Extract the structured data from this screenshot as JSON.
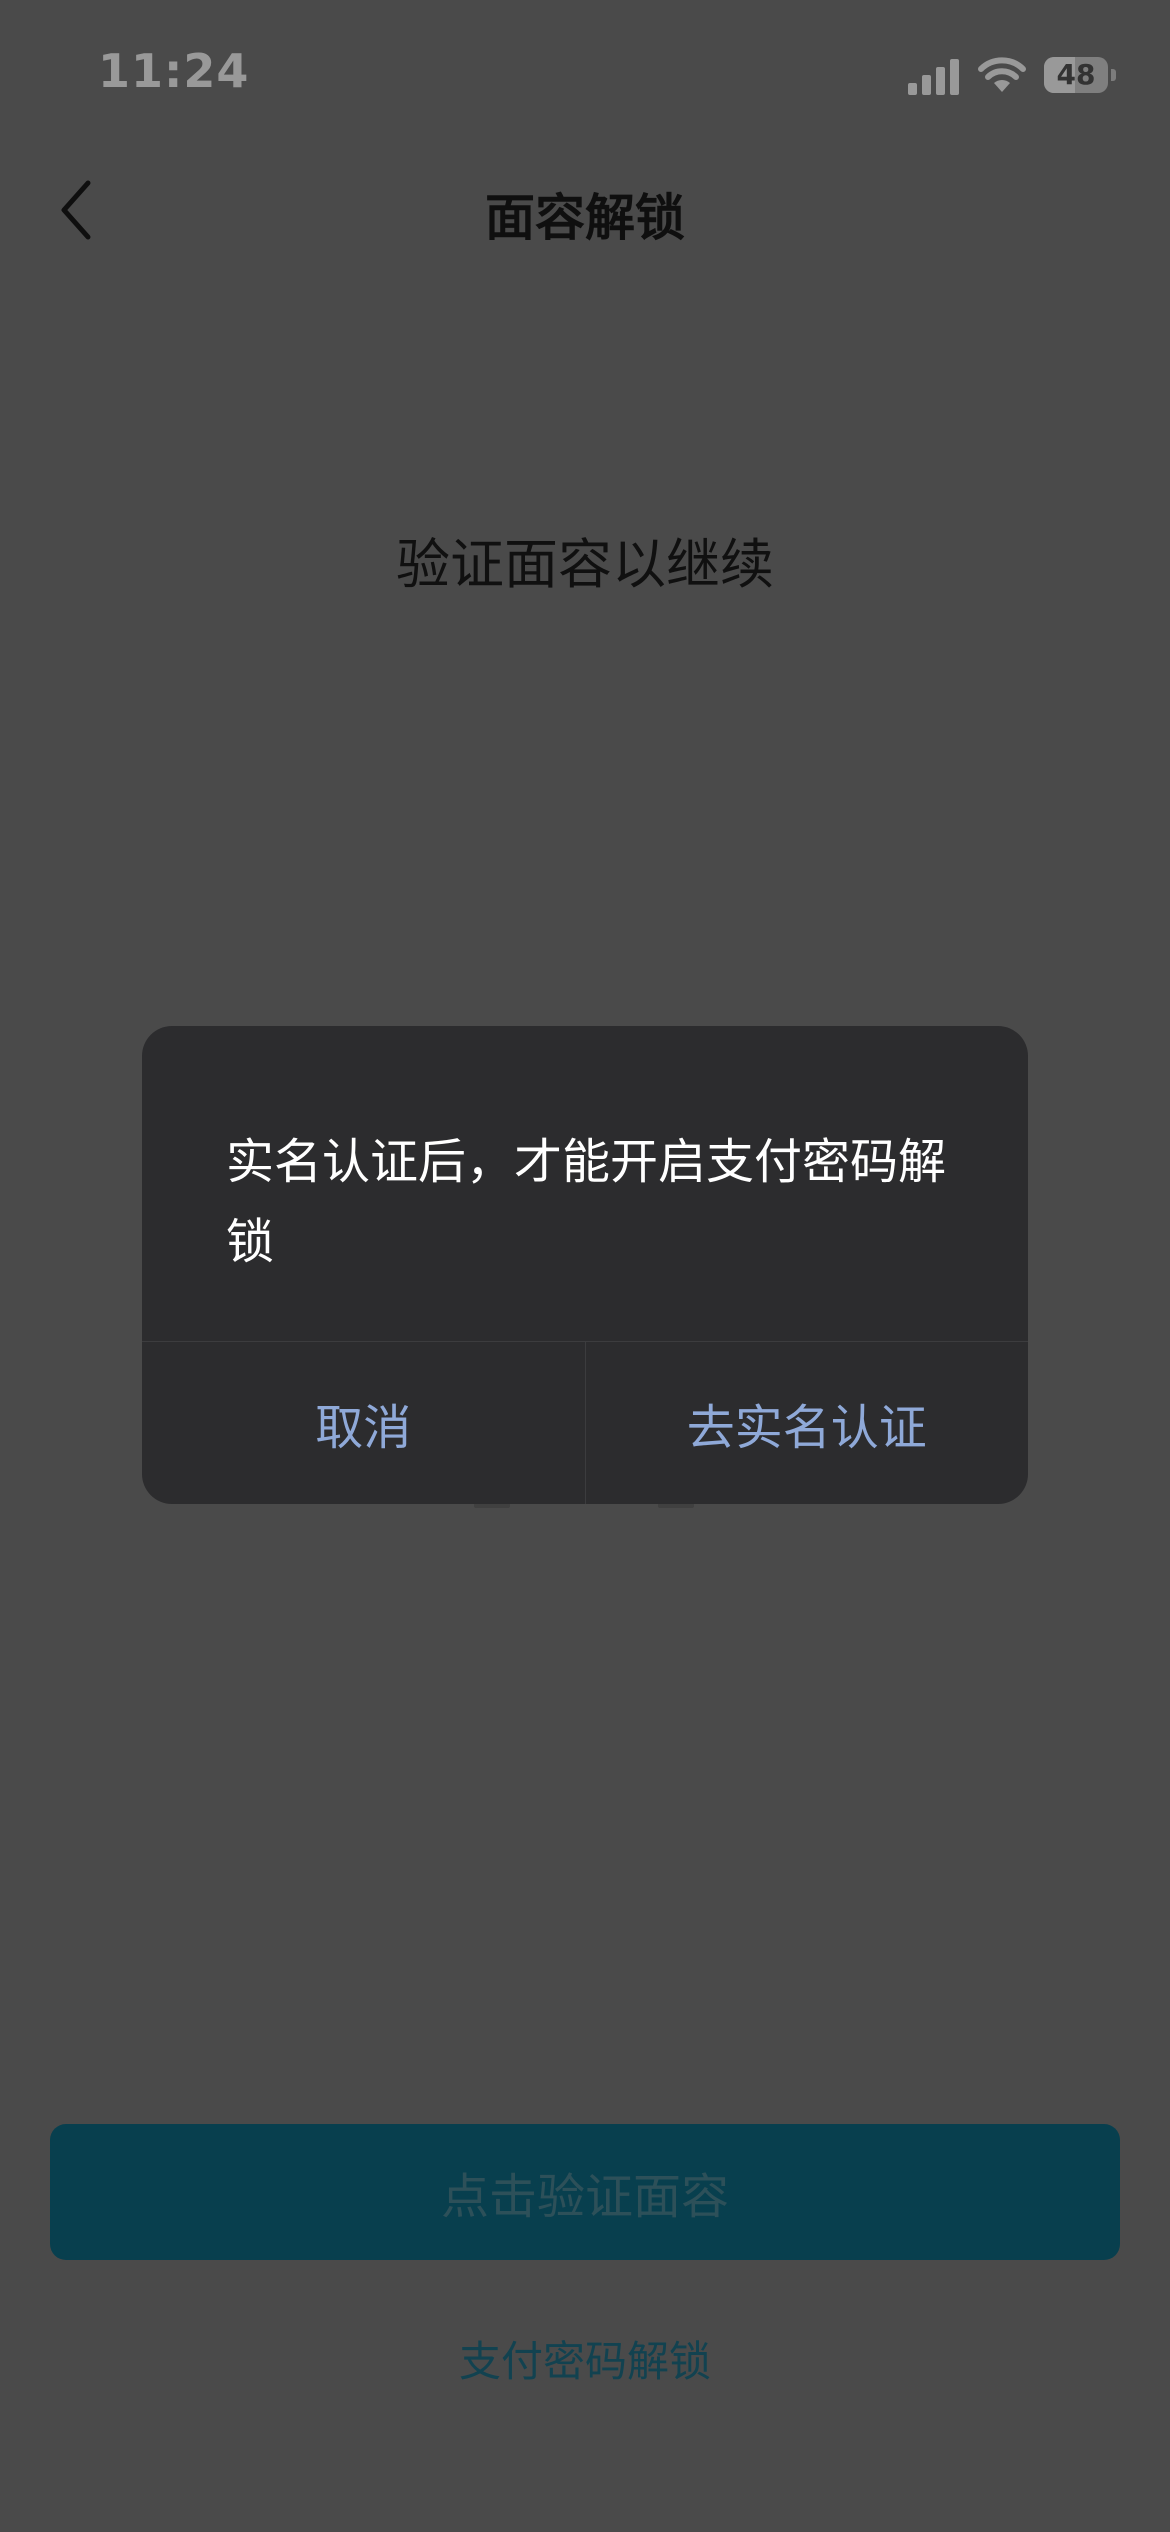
{
  "status_bar": {
    "time": "11:24",
    "battery_percent": "48",
    "battery_level": 0.48
  },
  "navbar": {
    "title": "面容解锁"
  },
  "main": {
    "headline": "验证面容以继续",
    "primary_button_label": "点击验证面容",
    "secondary_link_label": "支付密码解锁"
  },
  "dialog": {
    "message": "实名认证后，才能开启支付密码解锁",
    "cancel_label": "取消",
    "confirm_label": "去实名认证"
  },
  "colors": {
    "primary_button": "#0e6a82",
    "dialog_action_text": "#8fa9d8",
    "dialog_background": "#2c2c2e"
  }
}
